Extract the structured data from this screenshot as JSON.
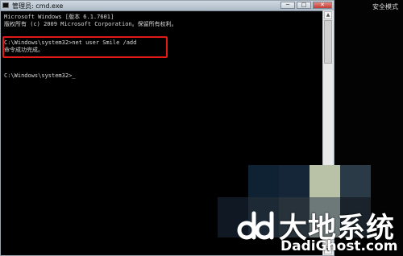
{
  "window": {
    "title": "管理员: cmd.exe",
    "controls": {
      "minimize": "─",
      "maximize": "□",
      "close": "✕"
    }
  },
  "desktop": {
    "label": "安全模式"
  },
  "console": {
    "lines": [
      "Microsoft Windows [版本 6.1.7601]",
      "版权所有 (c) 2009 Microsoft Corporation。保留所有权利。",
      "C:\\Windows\\system32>net user Smile /add",
      "命令成功完成。",
      "C:\\Windows\\system32>_"
    ]
  },
  "scrollbar": {
    "up": "▲",
    "down": "▼"
  },
  "watermark": {
    "text": "大地系统",
    "url": "DadiGhost.com"
  },
  "colors": {
    "highlight": "#e01818",
    "console_bg": "#000000",
    "console_text": "#d8d8d8"
  }
}
